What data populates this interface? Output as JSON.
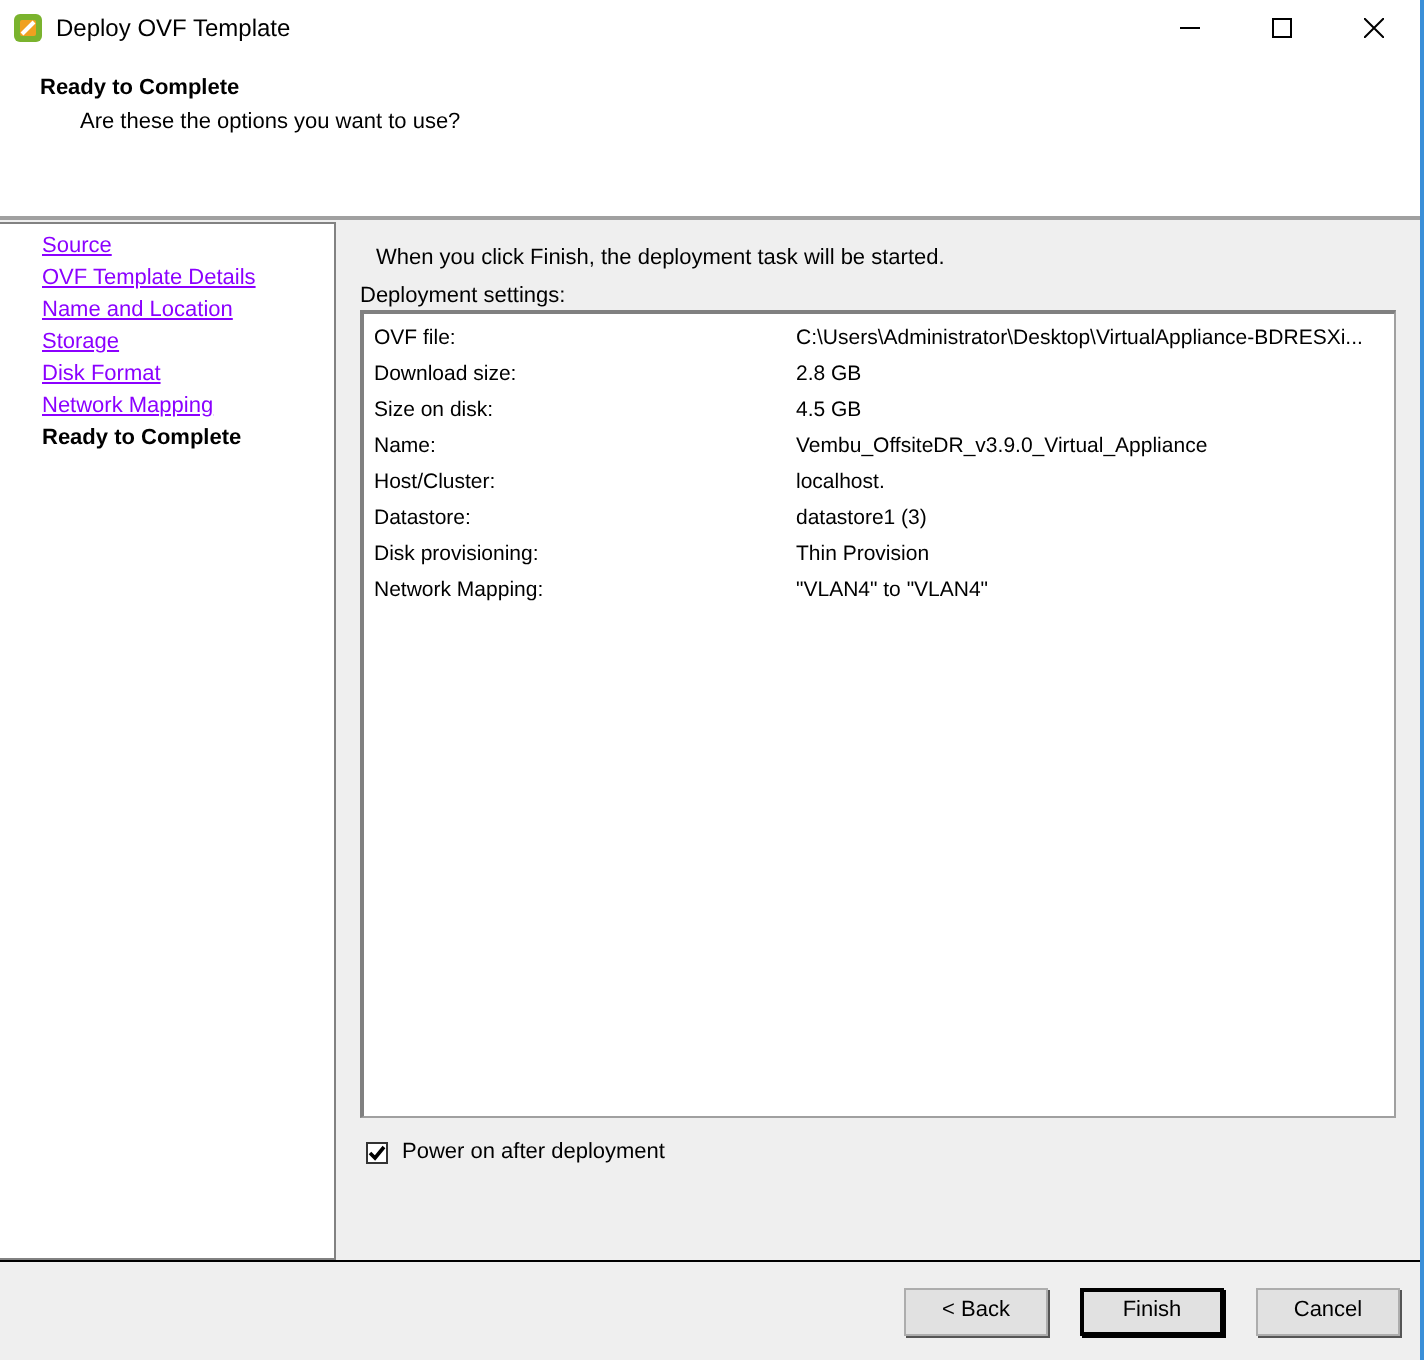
{
  "window": {
    "title": "Deploy OVF Template"
  },
  "header": {
    "title": "Ready to Complete",
    "subtitle": "Are these the options you want to use?"
  },
  "steps": [
    {
      "label": "Source",
      "selected": false
    },
    {
      "label": "OVF Template Details",
      "selected": false
    },
    {
      "label": "Name and Location",
      "selected": false
    },
    {
      "label": "Storage",
      "selected": false
    },
    {
      "label": "Disk Format",
      "selected": false
    },
    {
      "label": "Network Mapping",
      "selected": false
    },
    {
      "label": "Ready to Complete",
      "selected": true
    }
  ],
  "intro": "When you click Finish, the deployment task will be started.",
  "settings_label": "Deployment settings:",
  "settings": [
    {
      "name": "OVF file:",
      "value": "C:\\Users\\Administrator\\Desktop\\VirtualAppliance-BDRESXi..."
    },
    {
      "name": "Download size:",
      "value": "2.8 GB"
    },
    {
      "name": "Size on disk:",
      "value": "4.5 GB"
    },
    {
      "name": "Name:",
      "value": "Vembu_OffsiteDR_v3.9.0_Virtual_Appliance"
    },
    {
      "name": "Host/Cluster:",
      "value": "localhost."
    },
    {
      "name": "Datastore:",
      "value": "datastore1 (3)"
    },
    {
      "name": "Disk provisioning:",
      "value": "Thin Provision"
    },
    {
      "name": "Network Mapping:",
      "value": "\"VLAN4\" to \"VLAN4\""
    }
  ],
  "power_on": {
    "label": "Power on after deployment",
    "checked": true
  },
  "buttons": [
    {
      "label": "< Back",
      "default": false
    },
    {
      "label": "Finish",
      "default": true
    },
    {
      "label": "Cancel",
      "default": false
    }
  ]
}
